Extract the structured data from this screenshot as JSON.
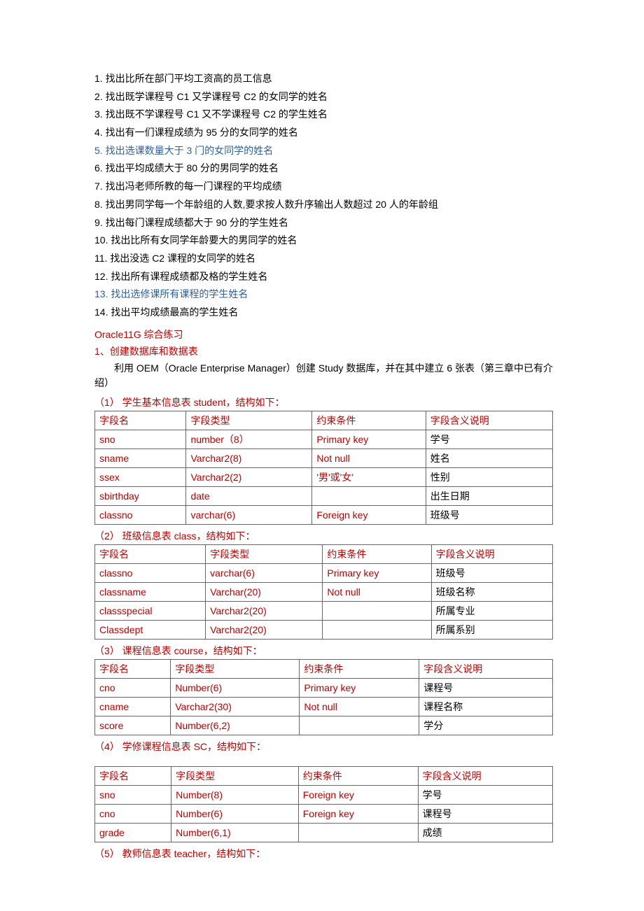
{
  "questions": [
    {
      "num": "1.",
      "text": "找出比所在部门平均工资高的员工信息",
      "cls": ""
    },
    {
      "num": "2.",
      "text": "找出既学课程号 C1 又学课程号 C2 的女同学的姓名",
      "cls": ""
    },
    {
      "num": "3.",
      "text": "找出既不学课程号 C1 又不学课程号 C2 的学生姓名",
      "cls": ""
    },
    {
      "num": "4.",
      "text": "找出有一们课程成绩为 95 分的女同学的姓名",
      "cls": ""
    },
    {
      "num": "5.",
      "text": "找出选课数量大于 3 门的女同学的姓名",
      "cls": "blue"
    },
    {
      "num": "6.",
      "text": "找出平均成绩大于 80 分的男同学的姓名",
      "cls": ""
    },
    {
      "num": "7.",
      "text": "找出冯老师所教的每一门课程的平均成绩",
      "cls": ""
    },
    {
      "num": "8.",
      "text": "找出男同学每一个年龄组的人数,要求按人数升序输出人数超过 20 人的年龄组",
      "cls": ""
    },
    {
      "num": "9.",
      "text": "找出每门课程成绩都大于 90 分的学生姓名",
      "cls": ""
    },
    {
      "num": "10.",
      "text": "找出比所有女同学年龄要大的男同学的姓名",
      "cls": ""
    },
    {
      "num": "11.",
      "text": "找出没选 C2 课程的女同学的姓名",
      "cls": ""
    },
    {
      "num": "12.",
      "text": "找出所有课程成绩都及格的学生姓名",
      "cls": ""
    },
    {
      "num": "13.",
      "text": "找出选修课所有课程的学生姓名",
      "cls": "blue"
    },
    {
      "num": "14.",
      "text": "找出平均成绩最高的学生姓名",
      "cls": ""
    }
  ],
  "title": "Oracle11G 综合练习",
  "section1": "1、创建数据库和数据表",
  "para1": "利用 OEM（Oracle Enterprise Manager）创建 Study 数据库，并在其中建立 6 张表（第三章中已有介绍）",
  "tblTitles": {
    "t1": "（1）  学生基本信息表 student，结构如下：",
    "t2": "（2）  班级信息表 class，结构如下：",
    "t3": "（3）  课程信息表 course，结构如下：",
    "t4": "（4）  学修课程信息表 SC，结构如下：",
    "t5": "（5）  教师信息表 teacher，结构如下："
  },
  "headers": {
    "c1": "字段名",
    "c2": "字段类型",
    "c3": "约束条件",
    "c4": "字段含义说明"
  },
  "t1": [
    [
      "sno",
      "number（8）",
      "Primary key",
      "学号"
    ],
    [
      "sname",
      "Varchar2(8)",
      "Not null",
      "姓名"
    ],
    [
      "ssex",
      "Varchar2(2)",
      "'男'或'女'",
      "性别"
    ],
    [
      "sbirthday",
      "date",
      "",
      "出生日期"
    ],
    [
      "classno",
      "varchar(6)",
      "Foreign key",
      "班级号"
    ]
  ],
  "t2": [
    [
      "classno",
      "varchar(6)",
      "Primary key",
      "班级号"
    ],
    [
      "classname",
      "Varchar(20)",
      "Not null",
      "班级名称"
    ],
    [
      "classspecial",
      "Varchar2(20)",
      "",
      "所属专业"
    ],
    [
      "Classdept",
      "Varchar2(20)",
      "",
      "所属系别"
    ]
  ],
  "t3": [
    [
      "cno",
      "Number(6)",
      "Primary key",
      "课程号"
    ],
    [
      "cname",
      "Varchar2(30)",
      "Not null",
      "课程名称"
    ],
    [
      "score",
      "Number(6,2)",
      "",
      "学分"
    ]
  ],
  "t4": [
    [
      "sno",
      "Number(8)",
      "Foreign key",
      "学号"
    ],
    [
      "cno",
      "Number(6)",
      "Foreign key",
      "课程号"
    ],
    [
      "grade",
      "Number(6,1)",
      "",
      "成绩"
    ]
  ]
}
